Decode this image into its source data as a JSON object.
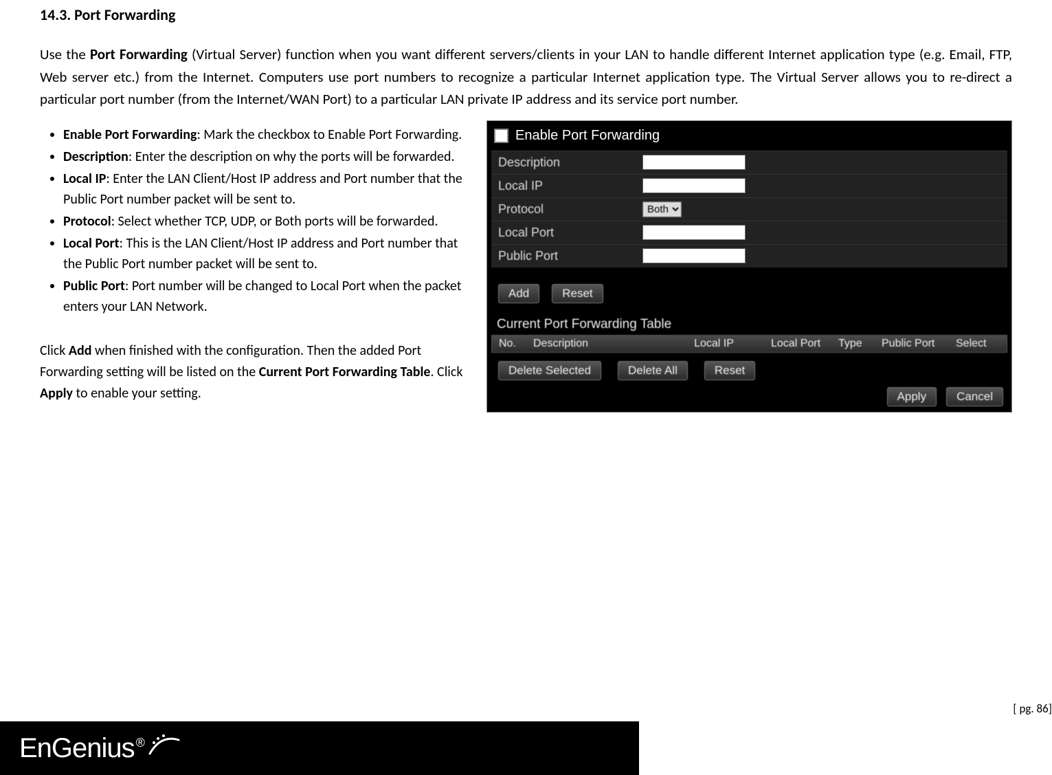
{
  "heading": "14.3.  Port Forwarding",
  "para_pre": "Use the ",
  "para_bold": "Port Forwarding",
  "para_post": " (Virtual Server) function when you want different servers/clients in your LAN to handle different Internet application type (e.g. Email, FTP, Web server etc.) from the Internet. Computers use port numbers to recognize a particular Internet application type. The Virtual Server allows you to re-direct a particular port number (from the Internet/WAN Port) to a particular LAN private IP address and its service port number.",
  "bullets": {
    "b1_label": "Enable Port Forwarding",
    "b1_text": ": Mark the checkbox to Enable Port Forwarding.",
    "b2_label": "Description",
    "b2_text": ": Enter the description on why the ports will be forwarded.",
    "b3_label": "Local IP",
    "b3_text": ": Enter the LAN Client/Host IP address and Port number that the Public Port number packet will be sent to.",
    "b4_label": "Protocol",
    "b4_text": ": Select whether TCP, UDP, or Both ports will be forwarded.",
    "b5_label": "Local Port",
    "b5_text": ": This is the LAN Client/Host IP address and Port number that the Public Port number packet will be sent to.",
    "b6_label": "Public Port",
    "b6_text": ": Port number will be changed to Local Port when the packet enters your LAN Network."
  },
  "after_a": "Click ",
  "after_add": "Add",
  "after_b": " when finished with the configuration. Then the added Port Forwarding setting will be listed on the ",
  "after_table": "Current Port Forwarding Table",
  "after_c": ". Click ",
  "after_apply": "Apply",
  "after_d": " to enable your setting.",
  "form": {
    "enable_label": "Enable Port Forwarding",
    "desc": "Description",
    "local_ip": "Local IP",
    "protocol": "Protocol",
    "protocol_value": "Both",
    "local_port": "Local Port",
    "public_port": "Public Port",
    "add": "Add",
    "reset": "Reset",
    "table_title": "Current Port Forwarding Table",
    "col_no": "No.",
    "col_desc": "Description",
    "col_lip": "Local IP",
    "col_lport": "Local Port",
    "col_type": "Type",
    "col_pport": "Public Port",
    "col_select": "Select",
    "del_sel": "Delete Selected",
    "del_all": "Delete All",
    "reset2": "Reset",
    "apply": "Apply",
    "cancel": "Cancel"
  },
  "logo_text": "EnGenius",
  "logo_reg": "®",
  "page_number": "[ pg. 86]"
}
